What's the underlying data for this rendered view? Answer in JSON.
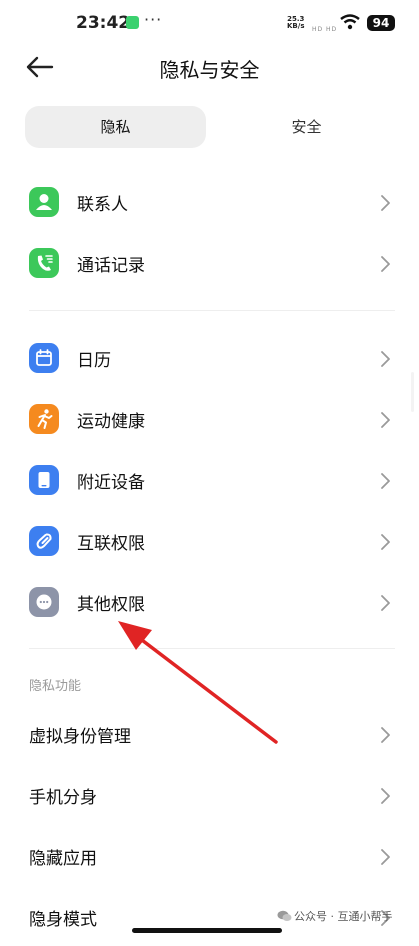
{
  "status_bar": {
    "time": "23:42",
    "dots": "···",
    "net_speed": "25.3",
    "net_unit": "KB/s",
    "hd": "HD HD",
    "battery": "94"
  },
  "header": {
    "title": "隐私与安全"
  },
  "tabs": [
    {
      "label": "隐私",
      "selected": true
    },
    {
      "label": "安全",
      "selected": false
    }
  ],
  "group1": [
    {
      "label": "联系人",
      "icon": "contact-icon",
      "color": "#3cc85a"
    },
    {
      "label": "通话记录",
      "icon": "call-log-icon",
      "color": "#3cc85a"
    }
  ],
  "group2": [
    {
      "label": "日历",
      "icon": "calendar-icon",
      "color": "#3d7ff0"
    },
    {
      "label": "运动健康",
      "icon": "running-icon",
      "color": "#f58a1f"
    },
    {
      "label": "附近设备",
      "icon": "tablet-icon",
      "color": "#3d7ff0"
    },
    {
      "label": "互联权限",
      "icon": "link-icon",
      "color": "#3d7ff0"
    },
    {
      "label": "其他权限",
      "icon": "more-icon",
      "color": "#8d94a8"
    }
  ],
  "privacy_section": {
    "title": "隐私功能",
    "items": [
      {
        "label": "虚拟身份管理"
      },
      {
        "label": "手机分身"
      },
      {
        "label": "隐藏应用"
      },
      {
        "label": "隐身模式"
      }
    ]
  },
  "watermark": "公众号 · 互通小帮手",
  "annotation_color": "#e02424"
}
